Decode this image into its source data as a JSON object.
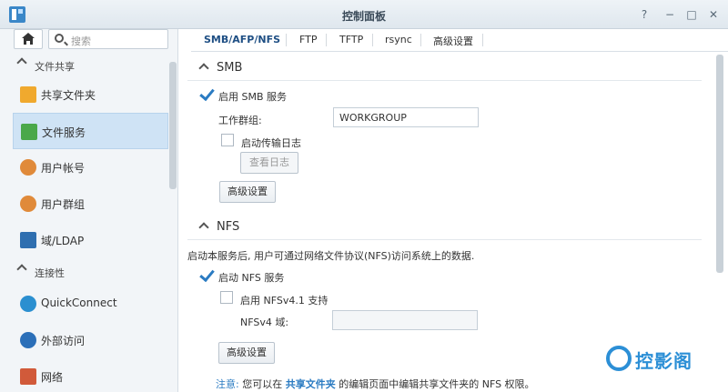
{
  "window": {
    "title": "控制面板",
    "help": "?",
    "minimize": "−",
    "maximize": "□",
    "close": "✕"
  },
  "sidebar": {
    "search_placeholder": "搜索",
    "sections": [
      {
        "label": "文件共享"
      },
      {
        "label": "连接性"
      }
    ],
    "items": [
      {
        "label": "共享文件夹",
        "icon": "shared-folder-icon",
        "color": "#f0a92e"
      },
      {
        "label": "文件服务",
        "icon": "file-services-icon",
        "color": "#4aa84a"
      },
      {
        "label": "用户帐号",
        "icon": "user-icon",
        "color": "#e08a3a"
      },
      {
        "label": "用户群组",
        "icon": "group-icon",
        "color": "#e08a3a"
      },
      {
        "label": "域/LDAP",
        "icon": "domain-icon",
        "color": "#2f6fb0"
      },
      {
        "label": "QuickConnect",
        "icon": "quickconnect-icon",
        "color": "#2b8fd0"
      },
      {
        "label": "外部访问",
        "icon": "globe-icon",
        "color": "#2b6fb8"
      },
      {
        "label": "网络",
        "icon": "network-icon",
        "color": "#d15a3a"
      }
    ]
  },
  "tabs": [
    "SMB/AFP/NFS",
    "FTP",
    "TFTP",
    "rsync",
    "高级设置"
  ],
  "smb": {
    "header": "SMB",
    "enable_label": "启用 SMB 服务",
    "workgroup_label": "工作群组:",
    "workgroup_value": "WORKGROUP",
    "transfer_log_label": "启动传输日志",
    "view_log_button": "查看日志",
    "advanced_button": "高级设置"
  },
  "nfs": {
    "header": "NFS",
    "description": "启动本服务后, 用户可通过网络文件协议(NFS)访问系统上的数据.",
    "enable_label": "启动 NFS 服务",
    "nfs41_label": "启用 NFSv4.1 支持",
    "domain_label": "NFSv4 域:",
    "domain_value": "",
    "advanced_button": "高级设置",
    "note_prefix": "注意:",
    "note_before": "您可以在",
    "note_link": "共享文件夹",
    "note_after": "的编辑页面中编辑共享文件夹的 NFS 权限。"
  },
  "watermark": {
    "text": "控影阁"
  }
}
